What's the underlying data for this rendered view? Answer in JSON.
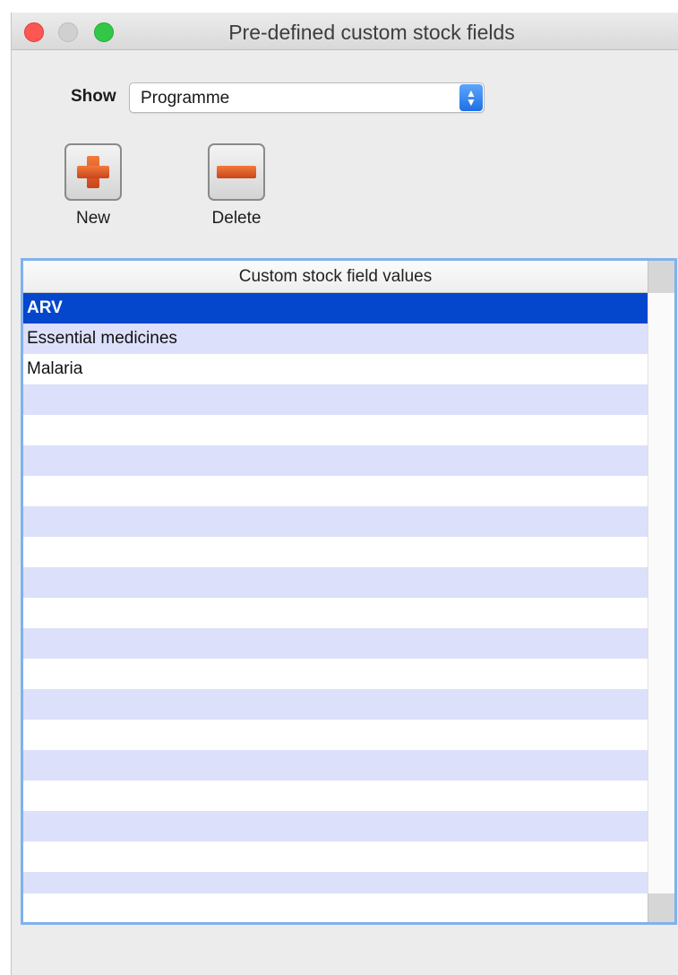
{
  "window": {
    "title": "Pre-defined custom stock fields"
  },
  "filter": {
    "label": "Show",
    "selected": "Programme"
  },
  "toolbar": {
    "new_label": "New",
    "delete_label": "Delete"
  },
  "table": {
    "column_header": "Custom stock field values",
    "selected_index": 0,
    "values": [
      "ARV",
      "Essential medicines",
      "Malaria"
    ],
    "visible_row_count": 20
  },
  "colors": {
    "selection": "#0447cc",
    "stripe": "#dce0fa",
    "focus_ring": "#7fb2ee",
    "button_icon": "#e0602a"
  },
  "icons": {
    "new": "plus-icon",
    "delete": "minus-icon",
    "select": "up-down-arrows-icon"
  }
}
